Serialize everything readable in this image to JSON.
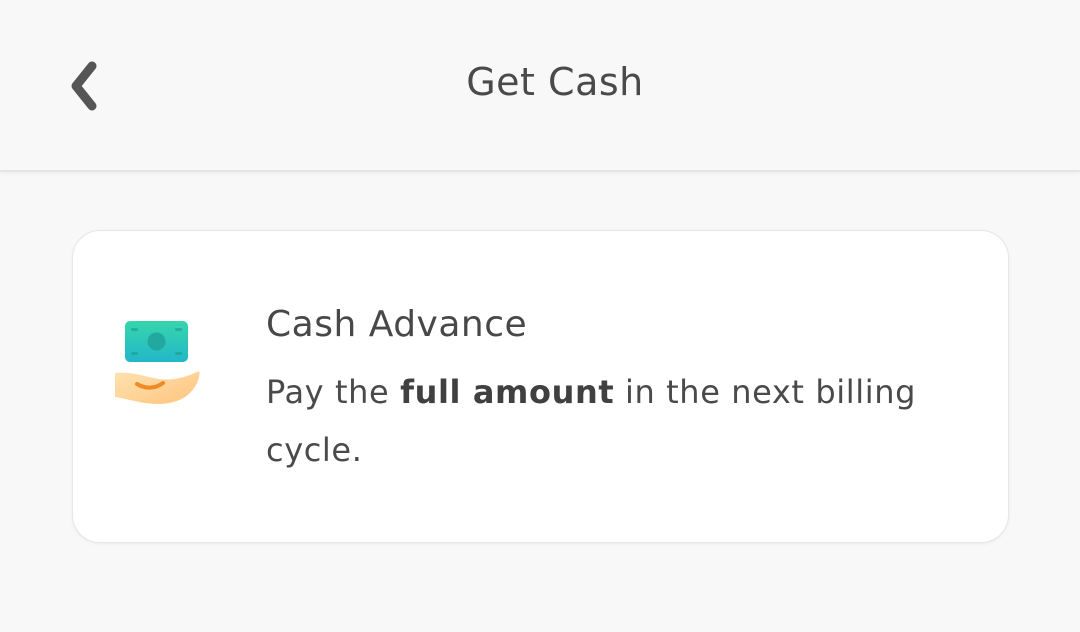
{
  "header": {
    "title": "Get Cash",
    "back_icon": "chevron-left-icon"
  },
  "card": {
    "icon": "cash-in-hand-icon",
    "title": "Cash Advance",
    "description_prefix": "Pay the ",
    "description_bold": "full amount",
    "description_suffix": " in the next billing cycle."
  },
  "colors": {
    "background": "#f8f8f8",
    "card": "#ffffff",
    "text": "#4a4a4a",
    "money_teal": "#2fc4b0",
    "hand": "#ffd49a",
    "hand_accent": "#f08a24"
  }
}
